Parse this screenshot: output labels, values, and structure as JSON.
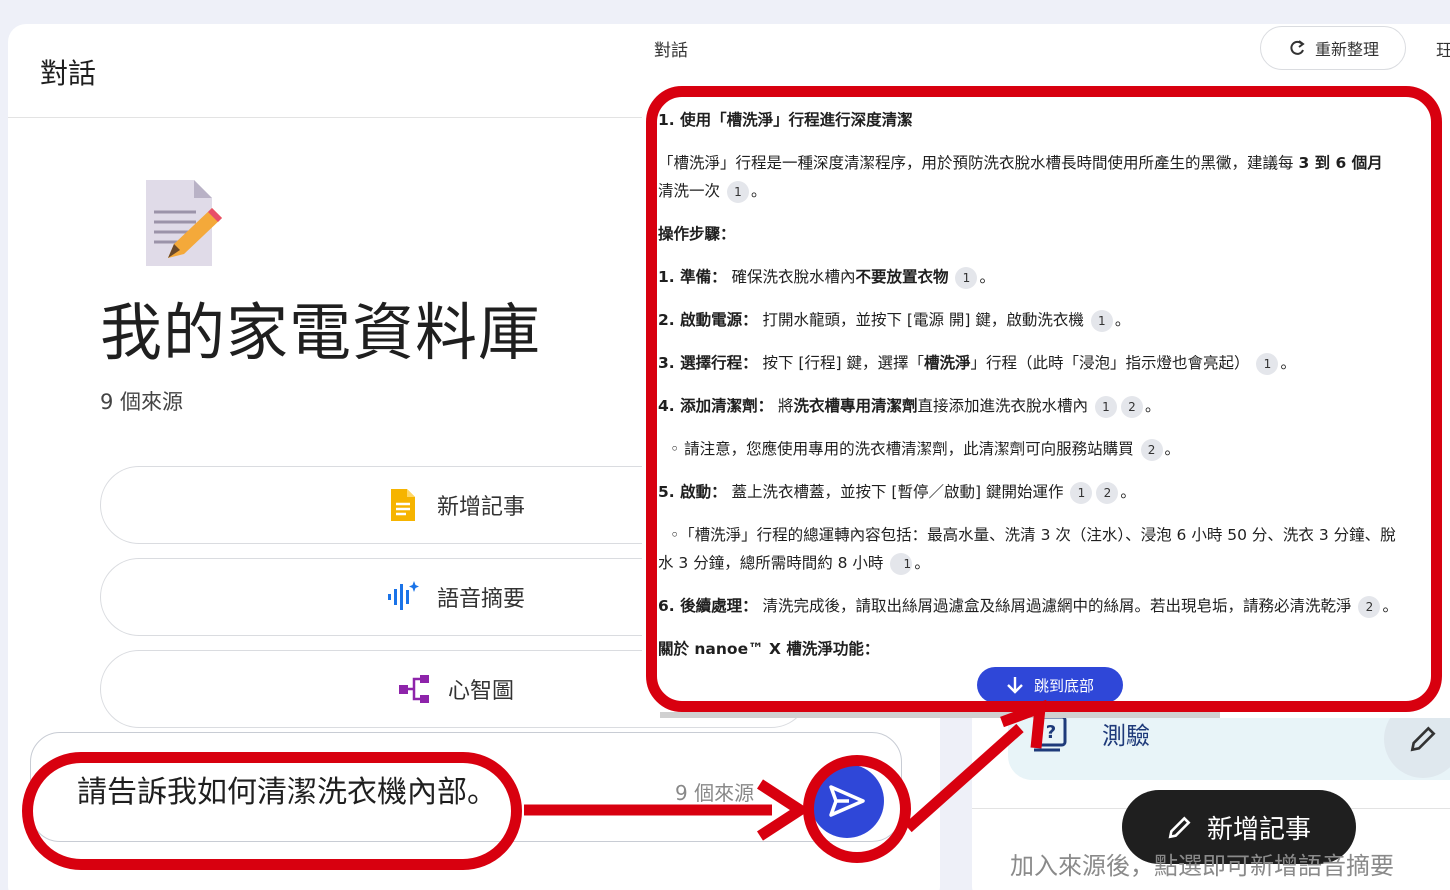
{
  "left_panel": {
    "header_title": "對話",
    "notebook_title": "我的家電資料庫",
    "source_count": "9 個來源",
    "actions": [
      {
        "label": "新增記事"
      },
      {
        "label": "語音摘要"
      },
      {
        "label": "心智圖"
      }
    ],
    "chat_input": {
      "value": "請告訴我如何清潔洗衣機內部。",
      "source_count": "9 個來源"
    }
  },
  "popup": {
    "title": "對話",
    "refresh_label": "重新整理",
    "cutoff_glyph": "玨",
    "jump_label": "跳到底部",
    "answer": {
      "heading": "1. 使用「槽洗淨」行程進行深度清潔",
      "intro_a": "「槽洗淨」行程是一種深度清潔程序，用於預防洗衣脫水槽長時間使用所產生的黑黴，建議每 ",
      "intro_b": "3 到 6 個月",
      "intro_c": "清洗一次",
      "steps_heading": "操作步驟：",
      "step1_title": "1. 準備：",
      "step1_a": " 確保洗衣脫水槽內",
      "step1_b": "不要放置衣物",
      "step2_title": "2. 啟動電源：",
      "step2_text": " 打開水龍頭，並按下 [電源 開] 鍵，啟動洗衣機",
      "step3_title": "3. 選擇行程：",
      "step3_a": " 按下 [行程] 鍵，選擇「",
      "step3_b": "槽洗淨",
      "step3_c": "」行程（此時「浸泡」指示燈也會亮起）",
      "step4_title": "4. 添加清潔劑：",
      "step4_a": " 將",
      "step4_b": "洗衣槽專用清潔劑",
      "step4_c": "直接添加進洗衣脫水槽內",
      "step4_note": "◦ 請注意，您應使用專用的洗衣槽清潔劑，此清潔劑可向服務站購買",
      "step5_title": "5. 啟動：",
      "step5_text": " 蓋上洗衣槽蓋，並按下 [暫停／啟動] 鍵開始運作",
      "step5_note": "◦「槽洗淨」行程的總運轉內容包括：最高水量、洗清 3 次（注水）、浸泡 6 小時 50 分、洗衣 3 分鐘、脫水 3 分鐘，總所需時間約 8 小時",
      "step6_title": "6. 後續處理：",
      "step6_text": " 清洗完成後，請取出絲屑過濾盒及絲屑過濾網中的絲屑。若出現皂垢，請務必清洗乾淨",
      "nanoe_heading": "關於 nanoe™ X 槽洗淨功能：",
      "cite_1": "1",
      "cite_2": "2"
    }
  },
  "studio_panel": {
    "quiz_label": "測驗",
    "add_note_label": "新增記事",
    "hint": "加入來源後，點選即可新增語音摘要"
  },
  "colors": {
    "annotation_red": "#d8000f",
    "send_blue": "#2f47d8"
  }
}
